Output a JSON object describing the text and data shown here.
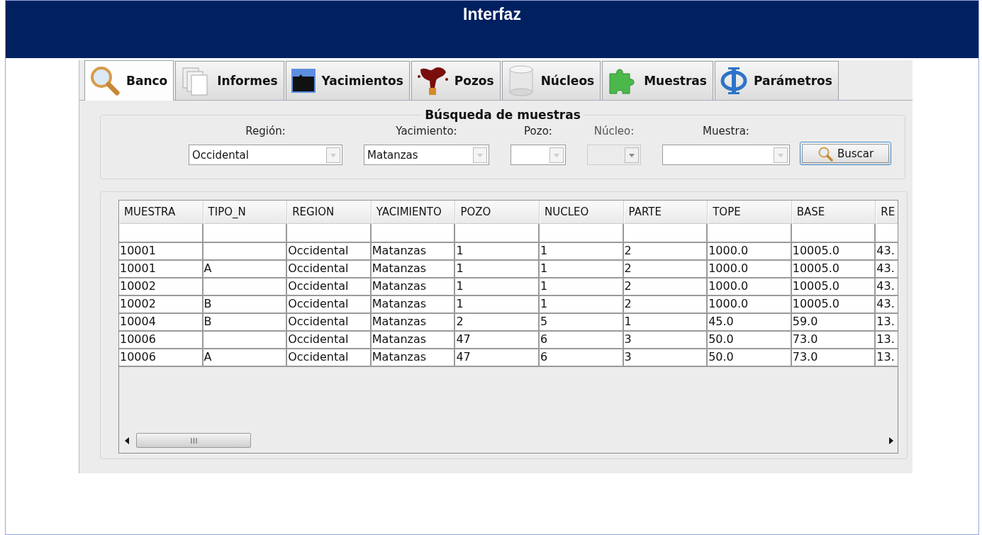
{
  "header": {
    "title": "Interfaz"
  },
  "tabs": [
    {
      "label": "Banco",
      "selected": true
    },
    {
      "label": "Informes",
      "selected": false
    },
    {
      "label": "Yacimientos",
      "selected": false
    },
    {
      "label": "Pozos",
      "selected": false
    },
    {
      "label": "Núcleos",
      "selected": false
    },
    {
      "label": "Muestras",
      "selected": false
    },
    {
      "label": "Parámetros",
      "selected": false
    }
  ],
  "search": {
    "title": "Búsqueda de muestras",
    "fields": [
      {
        "label": "Región:",
        "value": "Occidental",
        "disabled": false
      },
      {
        "label": "Yacimiento:",
        "value": "Matanzas",
        "disabled": false
      },
      {
        "label": "Pozo:",
        "disabled": false
      },
      {
        "label": "Núcleo:",
        "disabled": true
      },
      {
        "label": "Muestra:",
        "disabled": false
      }
    ],
    "button": "Buscar"
  },
  "table": {
    "columns": [
      "MUESTRA",
      "TIPO_N",
      "REGION",
      "YACIMIENTO",
      "POZO",
      "NUCLEO",
      "PARTE",
      "TOPE",
      "BASE",
      "RE"
    ],
    "rows": [
      [
        "10001",
        null,
        "Occidental",
        "Matanzas",
        "1",
        "1",
        "2",
        "1000.0",
        "10005.0",
        "43."
      ],
      [
        "10001",
        "A",
        "Occidental",
        "Matanzas",
        "1",
        "1",
        "2",
        "1000.0",
        "10005.0",
        "43."
      ],
      [
        "10002",
        null,
        "Occidental",
        "Matanzas",
        "1",
        "1",
        "2",
        "1000.0",
        "10005.0",
        "43."
      ],
      [
        "10002",
        "B",
        "Occidental",
        "Matanzas",
        "1",
        "1",
        "2",
        "1000.0",
        "10005.0",
        "43."
      ],
      [
        "10004",
        "B",
        "Occidental",
        "Matanzas",
        "2",
        "5",
        "1",
        "45.0",
        "59.0",
        "13."
      ],
      [
        "10006",
        null,
        "Occidental",
        "Matanzas",
        "47",
        "6",
        "3",
        "50.0",
        "73.0",
        "13."
      ],
      [
        "10006",
        "A",
        "Occidental",
        "Matanzas",
        "47",
        "6",
        "3",
        "50.0",
        "73.0",
        "13."
      ]
    ]
  }
}
